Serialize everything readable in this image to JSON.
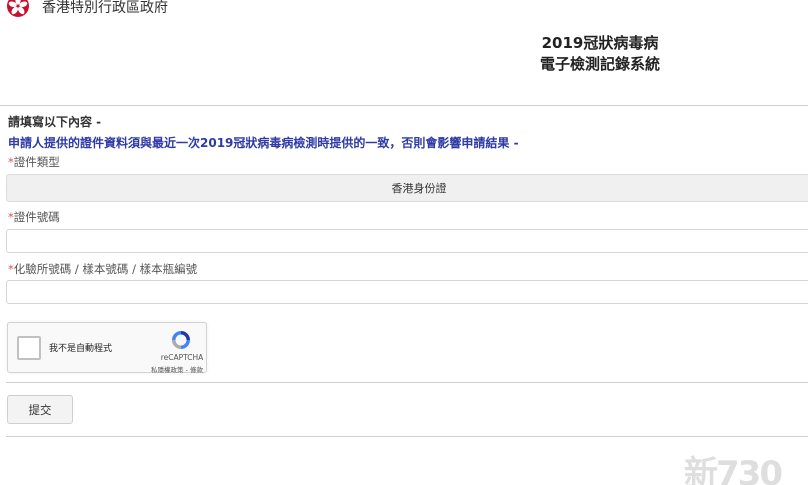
{
  "header": {
    "gov_name": "香港特別行政區政府",
    "logo_icon": "bauhinia-logo-icon"
  },
  "title": {
    "line1": "2019冠狀病毒病",
    "line2": "電子檢測記錄系統"
  },
  "form": {
    "intro": "請填寫以下內容 -",
    "notice": "申請人提供的證件資料須與最近一次2019冠狀病毒病檢測時提供的一致，否則會影響申請結果 -",
    "doc_type": {
      "label": "證件類型",
      "required_mark": "*",
      "selected": "香港身份證"
    },
    "doc_number": {
      "label": "證件號碼",
      "required_mark": "*",
      "value": ""
    },
    "lab_number": {
      "label": "化驗所號碼 / 樣本號碼 / 樣本瓶編號",
      "required_mark": "*",
      "value": ""
    },
    "recaptcha": {
      "label": "我不是自動程式",
      "brand": "reCAPTCHA",
      "terms": "私隱權政策 - 條款",
      "checked": false
    },
    "submit_label": "提交"
  },
  "watermark": "新730",
  "colors": {
    "notice_text": "#2e3aa6",
    "required_mark": "#d9534f",
    "logo_red": "#c8102e"
  }
}
